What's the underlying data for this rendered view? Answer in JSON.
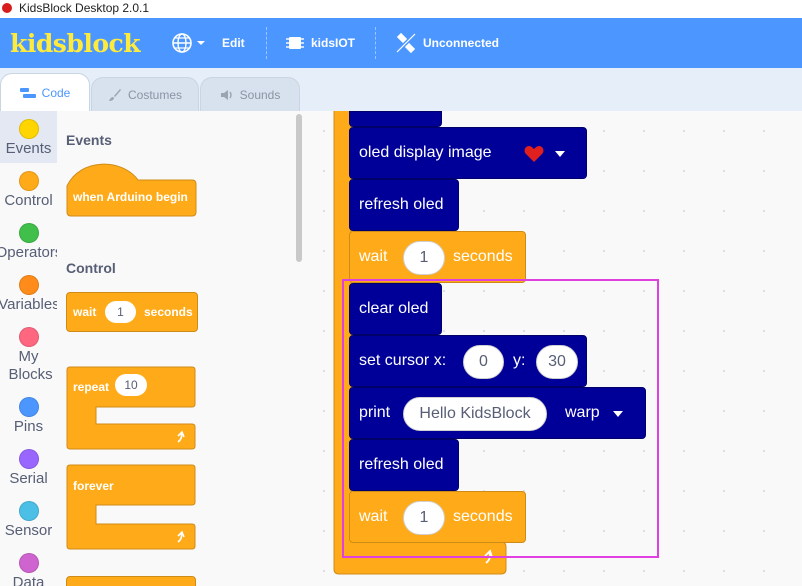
{
  "window": {
    "title": "KidsBlock Desktop 2.0.1"
  },
  "menubar": {
    "logo": "kidsblock",
    "edit": "Edit",
    "iot": "kidsIOT",
    "connection": "Unconnected",
    "icons": [
      "globe-icon",
      "chevron-down-icon",
      "chip-icon",
      "unplug-icon"
    ]
  },
  "tabs": [
    {
      "label": "Code",
      "icon": "code-icon",
      "active": true
    },
    {
      "label": "Costumes",
      "icon": "brush-icon",
      "active": false
    },
    {
      "label": "Sounds",
      "icon": "speaker-icon",
      "active": false
    }
  ],
  "categories": [
    {
      "label": "Events",
      "color": "#ffd500"
    },
    {
      "label": "Control",
      "color": "#ffab19"
    },
    {
      "label": "Operators",
      "color": "#40bf4a"
    },
    {
      "label": "Variables",
      "color": "#ff8c1a"
    },
    {
      "label": "My Blocks",
      "color": "#ff6680"
    },
    {
      "label": "Pins",
      "color": "#4c97ff"
    },
    {
      "label": "Serial",
      "color": "#9966ff"
    },
    {
      "label": "Sensor",
      "color": "#4cbfe6"
    },
    {
      "label": "Data",
      "color": "#cf63cf"
    }
  ],
  "palette": {
    "events_heading": "Events",
    "when_arduino_begin": "when Arduino begin",
    "control_heading": "Control",
    "wait_label": "wait",
    "wait_value": "1",
    "seconds_label": "seconds",
    "repeat_label": "repeat",
    "repeat_value": "10",
    "forever_label": "forever"
  },
  "workspace": {
    "oled_display_image": "oled display image",
    "refresh_oled": "refresh oled",
    "wait_label": "wait",
    "wait_value": "1",
    "seconds_label": "seconds",
    "clear_oled": "clear oled",
    "set_cursor_x": "set cursor x:",
    "cursor_x_value": "0",
    "y_label": "y:",
    "cursor_y_value": "30",
    "print_label": "print",
    "print_text": "Hello KidsBlock",
    "print_mode": "warp",
    "refresh_oled_2": "refresh oled",
    "wait_label_2": "wait",
    "wait_value_2": "1",
    "seconds_label_2": "seconds"
  },
  "colors": {
    "menubar": "#4c97ff",
    "logo": "#ffeb3b",
    "control_block": "#ffab19",
    "oled_block": "#000099",
    "highlight": "#e040e0",
    "heart": "#e0201e"
  }
}
